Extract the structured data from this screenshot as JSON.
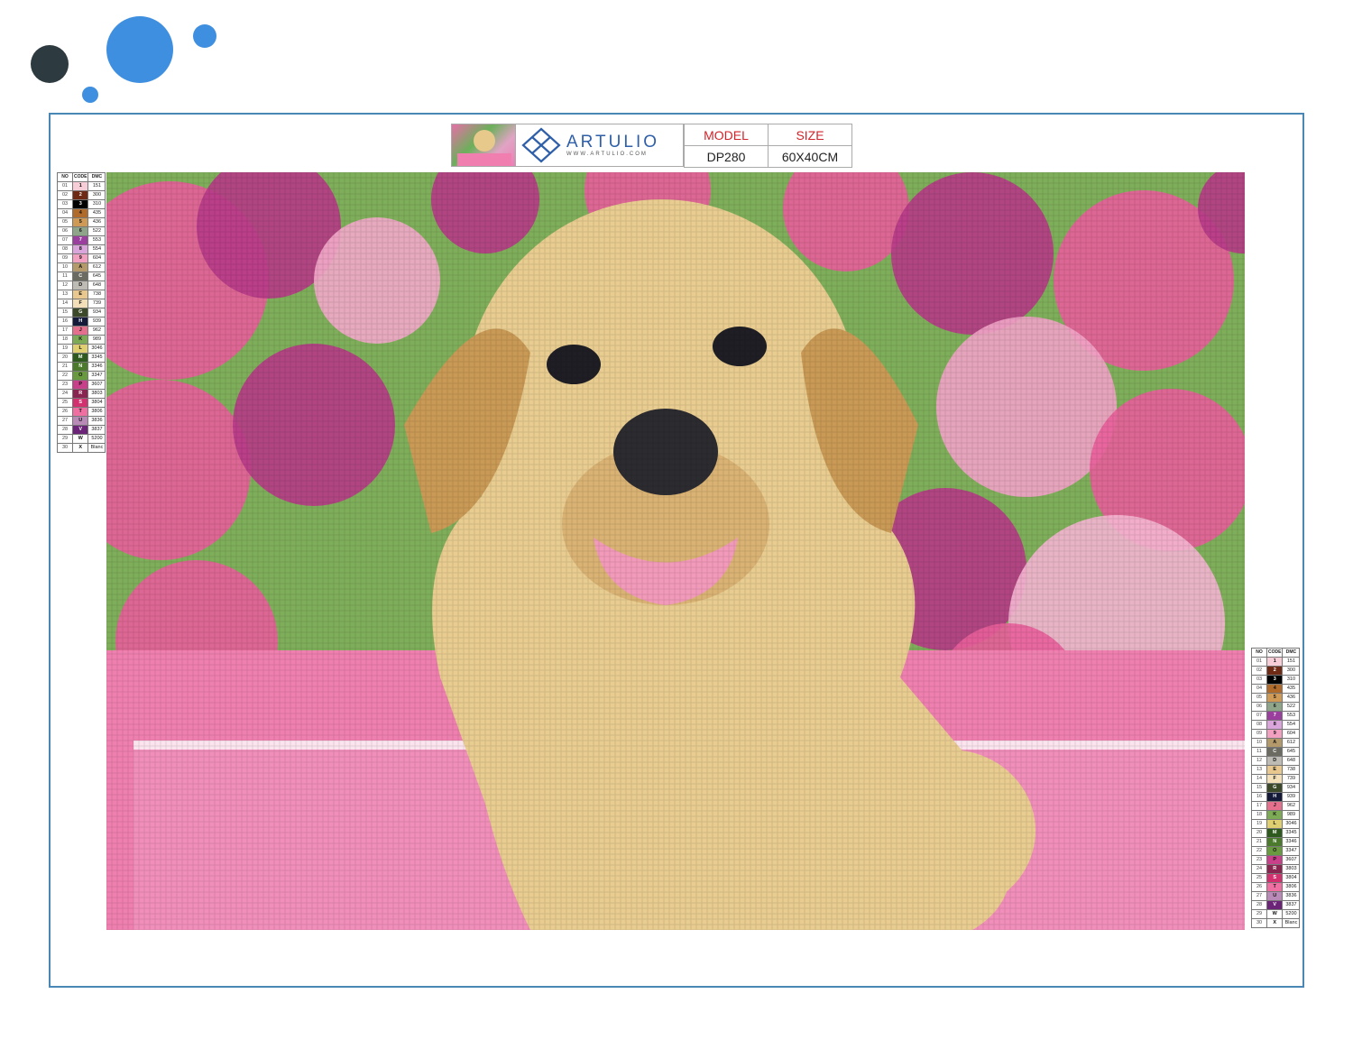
{
  "brand": {
    "name": "ARTULIO",
    "url": "WWW.ARTULIO.COM",
    "logo_icon": "diamond-lattice-icon"
  },
  "product": {
    "model_label": "MODEL",
    "size_label": "SIZE",
    "model_value": "DP280",
    "size_value": "60X40CM"
  },
  "legend": {
    "headers": [
      "NO",
      "CODE",
      "DMC"
    ],
    "rows": [
      {
        "no": "01",
        "code": "1",
        "dmc": "151",
        "color": "#f7cdd8"
      },
      {
        "no": "02",
        "code": "2",
        "dmc": "300",
        "color": "#6e2a14"
      },
      {
        "no": "03",
        "code": "3",
        "dmc": "310",
        "color": "#000000"
      },
      {
        "no": "04",
        "code": "4",
        "dmc": "435",
        "color": "#b06a2a"
      },
      {
        "no": "05",
        "code": "5",
        "dmc": "436",
        "color": "#cf9a55"
      },
      {
        "no": "06",
        "code": "6",
        "dmc": "522",
        "color": "#8fa58a"
      },
      {
        "no": "07",
        "code": "7",
        "dmc": "553",
        "color": "#9b3f9e"
      },
      {
        "no": "08",
        "code": "8",
        "dmc": "554",
        "color": "#d9a5db"
      },
      {
        "no": "09",
        "code": "9",
        "dmc": "604",
        "color": "#f2a0bf"
      },
      {
        "no": "10",
        "code": "A",
        "dmc": "612",
        "color": "#b49a6a"
      },
      {
        "no": "11",
        "code": "C",
        "dmc": "645",
        "color": "#6b6b62"
      },
      {
        "no": "12",
        "code": "D",
        "dmc": "648",
        "color": "#bdbbb3"
      },
      {
        "no": "13",
        "code": "E",
        "dmc": "738",
        "color": "#e9c890"
      },
      {
        "no": "14",
        "code": "F",
        "dmc": "739",
        "color": "#f3dfb8"
      },
      {
        "no": "15",
        "code": "G",
        "dmc": "934",
        "color": "#3d4a2a"
      },
      {
        "no": "16",
        "code": "H",
        "dmc": "939",
        "color": "#151a3a"
      },
      {
        "no": "17",
        "code": "J",
        "dmc": "962",
        "color": "#e5708e"
      },
      {
        "no": "18",
        "code": "K",
        "dmc": "989",
        "color": "#7dab55"
      },
      {
        "no": "19",
        "code": "L",
        "dmc": "3046",
        "color": "#e0cf70"
      },
      {
        "no": "20",
        "code": "M",
        "dmc": "3345",
        "color": "#2f5a1e"
      },
      {
        "no": "21",
        "code": "N",
        "dmc": "3346",
        "color": "#4b7a2c"
      },
      {
        "no": "22",
        "code": "O",
        "dmc": "3347",
        "color": "#6a9a3f"
      },
      {
        "no": "23",
        "code": "P",
        "dmc": "3607",
        "color": "#c9408a"
      },
      {
        "no": "24",
        "code": "R",
        "dmc": "3803",
        "color": "#8a2450"
      },
      {
        "no": "25",
        "code": "S",
        "dmc": "3804",
        "color": "#d3306f"
      },
      {
        "no": "26",
        "code": "T",
        "dmc": "3806",
        "color": "#f06fa3"
      },
      {
        "no": "27",
        "code": "U",
        "dmc": "3836",
        "color": "#b98ab8"
      },
      {
        "no": "28",
        "code": "V",
        "dmc": "3837",
        "color": "#6b2478"
      },
      {
        "no": "29",
        "code": "W",
        "dmc": "5200",
        "color": "#ffffff"
      },
      {
        "no": "30",
        "code": "X",
        "dmc": "Blanc",
        "color": "#fdfdfd"
      }
    ]
  },
  "artwork": {
    "palette": {
      "background_green": "#7fae5a",
      "flower_pink": "#e85f9a",
      "flower_magenta": "#b63a86",
      "box_pink": "#ee7fae",
      "dog_cream": "#e8cc90",
      "dog_tan": "#c99a55",
      "nose_dark": "#2b2b30",
      "tongue_pink": "#f29ab9"
    }
  }
}
